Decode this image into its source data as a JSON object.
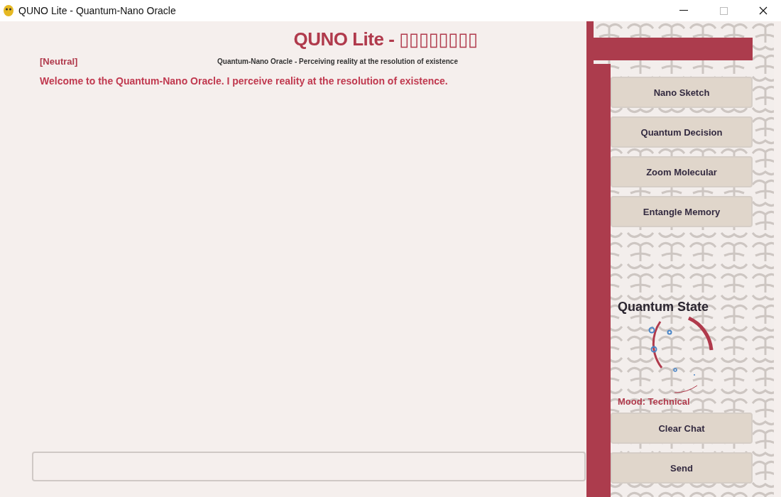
{
  "window": {
    "title": "QUNO Lite - Quantum-Nano Oracle"
  },
  "header": {
    "title": "QUNO Lite - ▯▯▯▯▯▯▯▯",
    "status": "[Neutral]",
    "subtitle": "Quantum-Nano Oracle - Perceiving reality at the resolution of existence"
  },
  "messages": [
    {
      "text": "Welcome to the Quantum-Nano Oracle. I perceive reality at the resolution of existence."
    }
  ],
  "sidebar": {
    "tools": [
      "Nano Sketch",
      "Quantum Decision",
      "Zoom Molecular",
      "Entangle Memory"
    ],
    "state_title": "Quantum State",
    "mood": "Mood: Technical",
    "actions": [
      "Clear Chat",
      "Send"
    ]
  }
}
